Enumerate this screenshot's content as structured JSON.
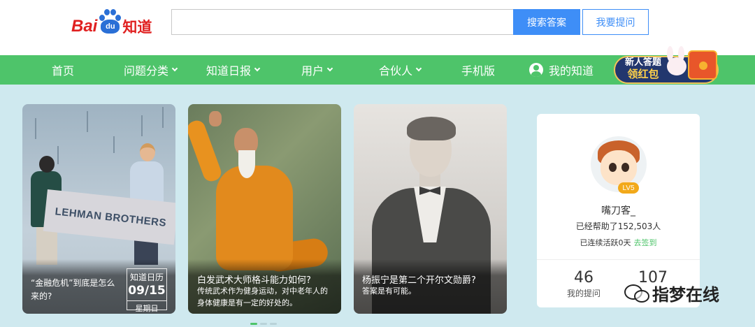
{
  "logo": {
    "bai": "Bai",
    "du": "du",
    "zhidao": "知道"
  },
  "search": {
    "placeholder": "",
    "value": "",
    "button": "搜索答案",
    "ask_button": "我要提问"
  },
  "nav": {
    "items": [
      {
        "label": "首页",
        "dropdown": false
      },
      {
        "label": "问题分类",
        "dropdown": true
      },
      {
        "label": "知道日报",
        "dropdown": true
      },
      {
        "label": "用户",
        "dropdown": true
      },
      {
        "label": "合伙人",
        "dropdown": true
      },
      {
        "label": "手机版",
        "dropdown": false
      }
    ],
    "my_zhidao": "我的知道",
    "promo": {
      "line1": "新人答题",
      "line2": "领红包"
    }
  },
  "cards": [
    {
      "banner_text": "LEHMAN BROTHERS",
      "title": "“金融危机”到底是怎么来的?",
      "date_box": {
        "label": "知道日历",
        "date": "09/15",
        "weekday": "星期日"
      }
    },
    {
      "title": "白发武术大师格斗能力如何?",
      "body": "传统武术作为健身运动，对中老年人的身体健康是有一定的好处的。"
    },
    {
      "title": "杨振宁是第二个开尔文勋爵?",
      "body": "答案是有可能。"
    }
  ],
  "profile": {
    "level": "LV5",
    "name": "嘴刀客_",
    "helped": "已经帮助了152,503人",
    "streak": "已连续活跃0天",
    "checkin": "去签到",
    "stats": [
      {
        "num": "46",
        "label": "我的提问"
      },
      {
        "num": "107",
        "label": ""
      }
    ]
  },
  "watermark": "指梦在线",
  "colors": {
    "nav_green": "#4ec46a",
    "accent_blue": "#3e8ef7",
    "logo_red": "#e02020",
    "logo_blue": "#2a6fd6"
  }
}
